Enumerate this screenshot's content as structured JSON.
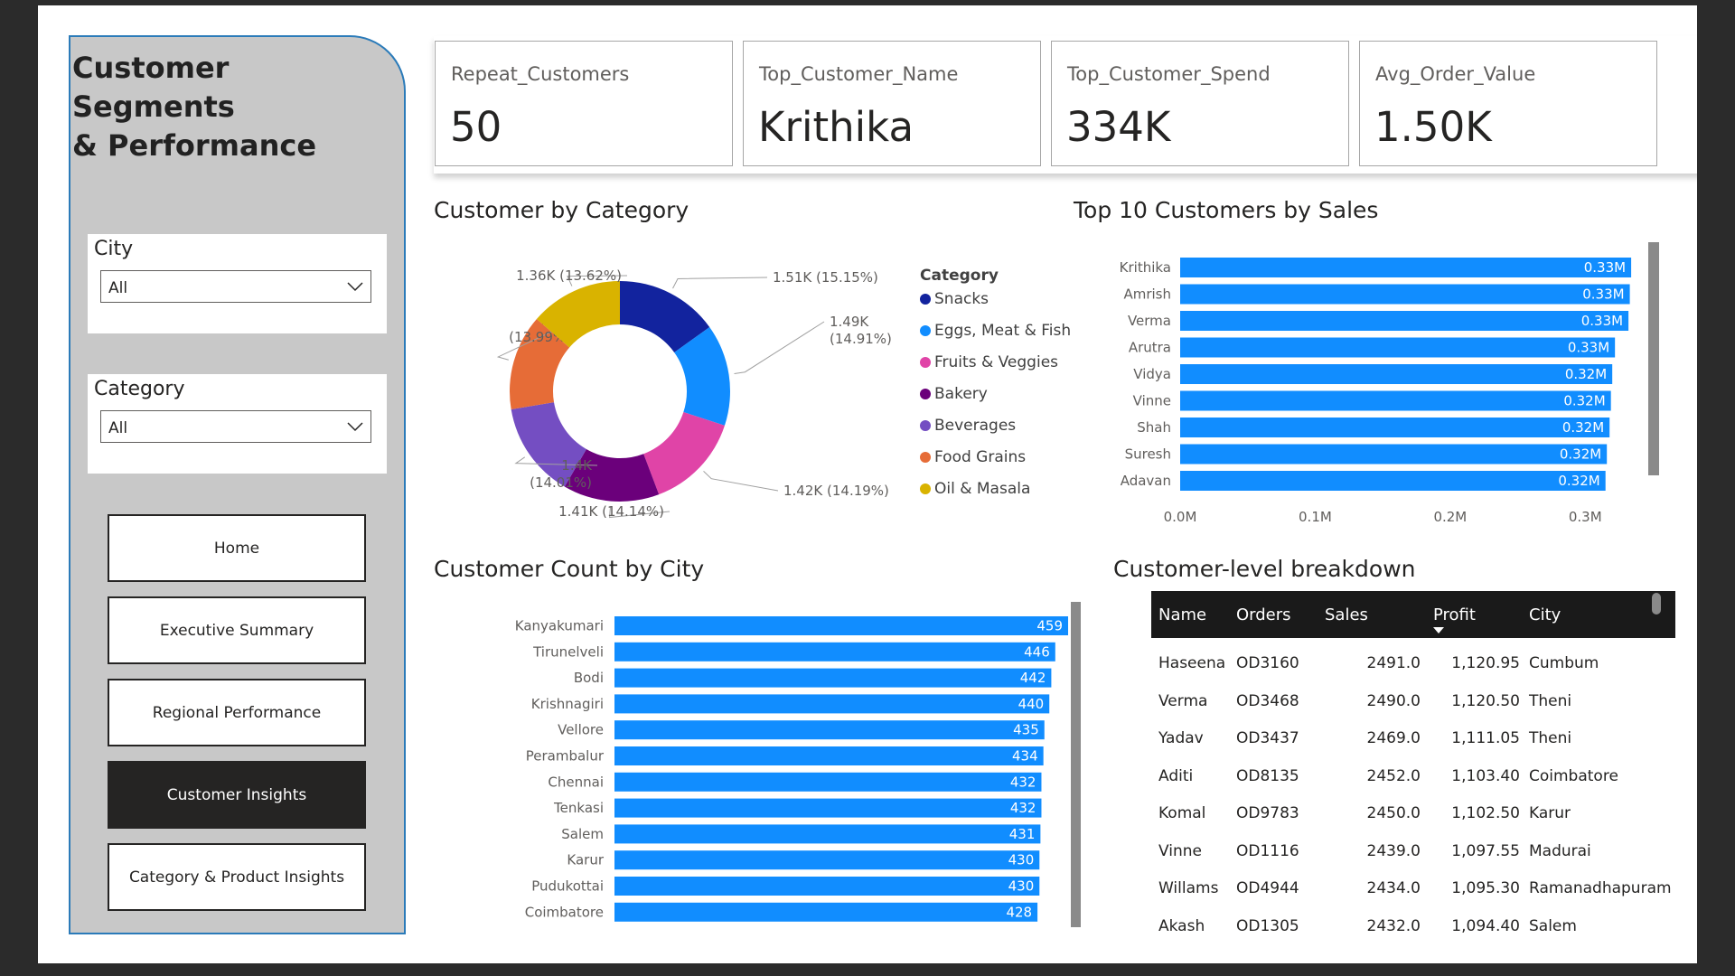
{
  "sidebar": {
    "title_line1": "Customer Segments",
    "title_line2": "& Performance",
    "city_slicer": {
      "label": "City",
      "value": "All"
    },
    "category_slicer": {
      "label": "Category",
      "value": "All"
    },
    "nav": [
      {
        "label": "Home",
        "active": false
      },
      {
        "label": "Executive Summary",
        "active": false
      },
      {
        "label": "Regional Performance",
        "active": false
      },
      {
        "label": "Customer Insights",
        "active": true
      },
      {
        "label": "Category & Product Insights",
        "active": false
      }
    ]
  },
  "kpis": [
    {
      "label": "Repeat_Customers",
      "value": "50"
    },
    {
      "label": "Top_Customer_Name",
      "value": "Krithika"
    },
    {
      "label": "Top_Customer_Spend",
      "value": "334K"
    },
    {
      "label": "Avg_Order_Value",
      "value": "1.50K"
    }
  ],
  "colors": {
    "bar": "#118DFF",
    "snacks": "#12239E",
    "eggs": "#118DFF",
    "fruits": "#E044A7",
    "bakery": "#6B007B",
    "beverages": "#744EC2",
    "grains": "#E66C37",
    "oil": "#D9B300",
    "active_nav": "#252423",
    "sidebar_bg": "#C8C8C8"
  },
  "chart_data": [
    {
      "type": "pie",
      "title": "Customer by Category",
      "legend_title": "Category",
      "legend_position": "right",
      "categories": [
        "Snacks",
        "Eggs, Meat & Fish",
        "Fruits & Veggies",
        "Bakery",
        "Beverages",
        "Food Grains",
        "Oil & Masala"
      ],
      "values": [
        1510,
        1490,
        1420,
        1410,
        1400,
        1400,
        1360
      ],
      "percents": [
        15.15,
        14.91,
        14.19,
        14.14,
        14.01,
        13.99,
        13.62
      ],
      "labels": [
        "1.51K (15.15%)",
        "1.49K (14.91%)",
        "1.42K (14.19%)",
        "1.41K (14.14%)",
        "1.4K (14.01%)",
        "1.4K (13.99%)",
        "1.36K (13.62%)"
      ]
    },
    {
      "type": "bar",
      "orientation": "horizontal",
      "title": "Top 10 Customers by Sales",
      "categories": [
        "Krithika",
        "Amrish",
        "Verma",
        "Arutra",
        "Vidya",
        "Vinne",
        "Shah",
        "Suresh",
        "Adavan"
      ],
      "values": [
        0.334,
        0.333,
        0.332,
        0.322,
        0.32,
        0.319,
        0.318,
        0.316,
        0.315
      ],
      "data_labels": [
        "0.33M",
        "0.33M",
        "0.33M",
        "0.33M",
        "0.32M",
        "0.32M",
        "0.32M",
        "0.32M",
        "0.32M"
      ],
      "x_ticks": [
        "0.0M",
        "0.1M",
        "0.2M",
        "0.3M"
      ],
      "xlim": [
        0,
        0.35
      ],
      "grid": false
    },
    {
      "type": "bar",
      "orientation": "horizontal",
      "title": "Customer Count by City",
      "categories": [
        "Kanyakumari",
        "Tirunelveli",
        "Bodi",
        "Krishnagiri",
        "Vellore",
        "Perambalur",
        "Chennai",
        "Tenkasi",
        "Salem",
        "Karur",
        "Pudukottai",
        "Coimbatore"
      ],
      "values": [
        459,
        446,
        442,
        440,
        435,
        434,
        432,
        432,
        431,
        430,
        430,
        428
      ],
      "xlim": [
        0,
        459
      ],
      "grid": false
    }
  ],
  "table": {
    "title": "Customer-level breakdown",
    "columns": [
      "Name",
      "Orders",
      "Sales",
      "Profit",
      "City"
    ],
    "sort_column": "Profit",
    "rows": [
      [
        "Haseena",
        "OD3160",
        "2491.0",
        "1,120.95",
        "Cumbum"
      ],
      [
        "Verma",
        "OD3468",
        "2490.0",
        "1,120.50",
        "Theni"
      ],
      [
        "Yadav",
        "OD3437",
        "2469.0",
        "1,111.05",
        "Theni"
      ],
      [
        "Aditi",
        "OD8135",
        "2452.0",
        "1,103.40",
        "Coimbatore"
      ],
      [
        "Komal",
        "OD9783",
        "2450.0",
        "1,102.50",
        "Karur"
      ],
      [
        "Vinne",
        "OD1116",
        "2439.0",
        "1,097.55",
        "Madurai"
      ],
      [
        "Willams",
        "OD4944",
        "2434.0",
        "1,095.30",
        "Ramanadhapuram"
      ],
      [
        "Akash",
        "OD1305",
        "2432.0",
        "1,094.40",
        "Salem"
      ]
    ]
  }
}
